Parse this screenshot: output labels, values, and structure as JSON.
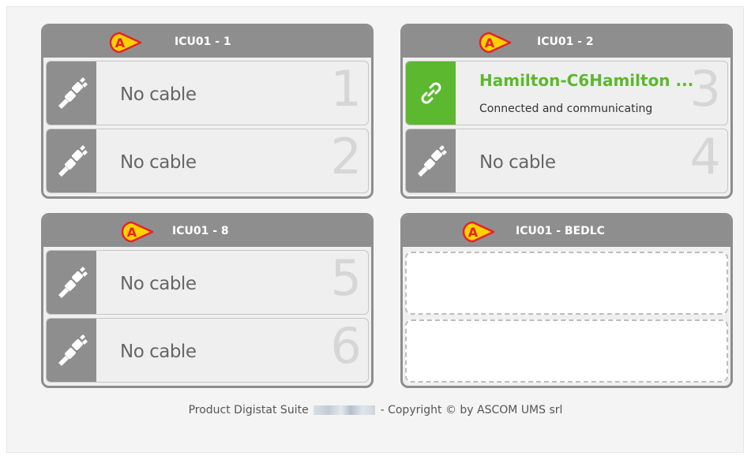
{
  "beds": [
    {
      "title": "ICU01 - 1",
      "slots": [
        {
          "text": "No cable",
          "number": "1",
          "icon": "unplugged-icon"
        },
        {
          "text": "No cable",
          "number": "2",
          "icon": "unplugged-icon"
        }
      ]
    },
    {
      "title": "ICU01 - 2",
      "slots": [
        {
          "name": "Hamilton-C6Hamilton ...",
          "status": "Connected and communicating",
          "number": "3",
          "icon": "link-icon"
        },
        {
          "text": "No cable",
          "number": "4",
          "icon": "unplugged-icon"
        }
      ]
    },
    {
      "title": "ICU01 - 8",
      "slots": [
        {
          "text": "No cable",
          "number": "5",
          "icon": "unplugged-icon"
        },
        {
          "text": "No cable",
          "number": "6",
          "icon": "unplugged-icon"
        }
      ]
    },
    {
      "title": "ICU01 - BEDLC",
      "slots": []
    }
  ],
  "badge_label": "A",
  "footer": {
    "left": "Product Digistat Suite",
    "right": "- Copyright © by ASCOM UMS srl"
  },
  "colors": {
    "header_gray": "#8e8e8e",
    "connected_green": "#5cb82f",
    "badge_red": "#e8202a",
    "badge_yellow": "#ffd200"
  }
}
